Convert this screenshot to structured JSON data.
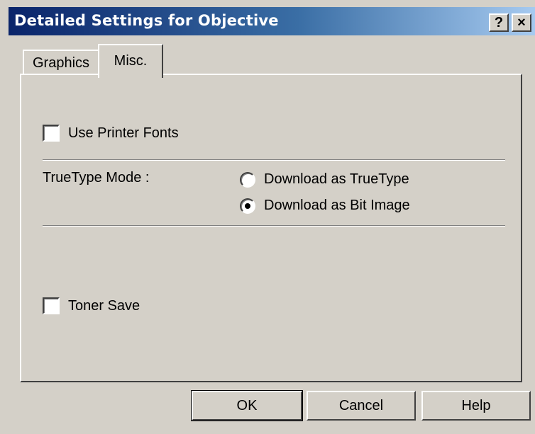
{
  "window": {
    "title": "Detailed Settings for Objective",
    "help_button": "?",
    "close_button": "×"
  },
  "tabs": [
    {
      "label": "Graphics",
      "active": false
    },
    {
      "label": "Misc.",
      "active": true
    }
  ],
  "misc": {
    "use_printer_fonts": {
      "label": "Use Printer Fonts",
      "checked": false
    },
    "truetype_mode": {
      "label": "TrueType Mode :",
      "options": [
        {
          "label": "Download as TrueType",
          "selected": false
        },
        {
          "label": "Download as Bit Image",
          "selected": true
        }
      ]
    },
    "toner_save": {
      "label": "Toner Save",
      "checked": false
    }
  },
  "buttons": {
    "ok": "OK",
    "cancel": "Cancel",
    "help": "Help"
  }
}
